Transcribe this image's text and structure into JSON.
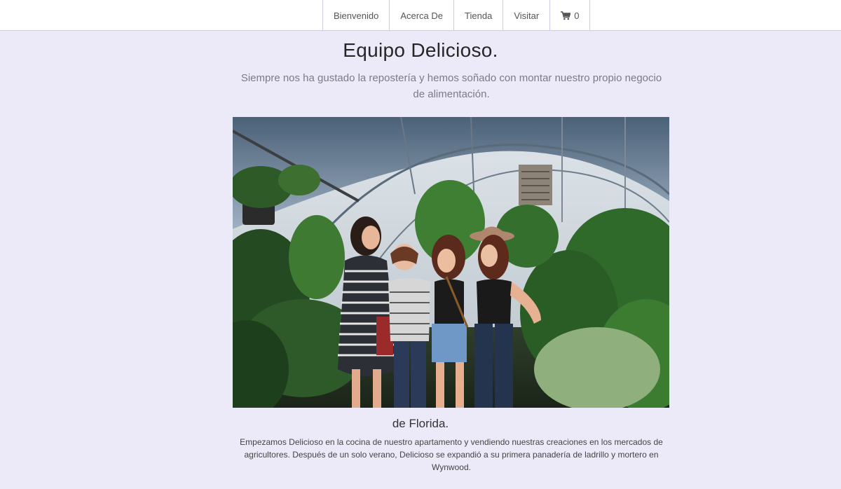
{
  "nav": {
    "items": [
      {
        "label": "Bienvenido"
      },
      {
        "label": "Acerca De"
      },
      {
        "label": "Tienda"
      },
      {
        "label": "Visitar"
      }
    ],
    "cart": {
      "icon": "shopping-cart-icon",
      "count": "0"
    }
  },
  "hero": {
    "title": "Equipo Delicioso.",
    "subtitle": "Siempre nos ha gustado la repostería y hemos soñado con montar nuestro propio negocio de alimentación."
  },
  "story": {
    "title": "de Florida.",
    "text": "Empezamos Delicioso en la cocina de nuestro apartamento y vendiendo nuestras creaciones en los mercados de agricultores. Después de un solo verano, Delicioso se expandió a su primera panadería de ladrillo y mortero en Wynwood."
  },
  "colors": {
    "background": "#eceaf8",
    "topbar": "#ffffff",
    "border": "#cfcbe6"
  }
}
